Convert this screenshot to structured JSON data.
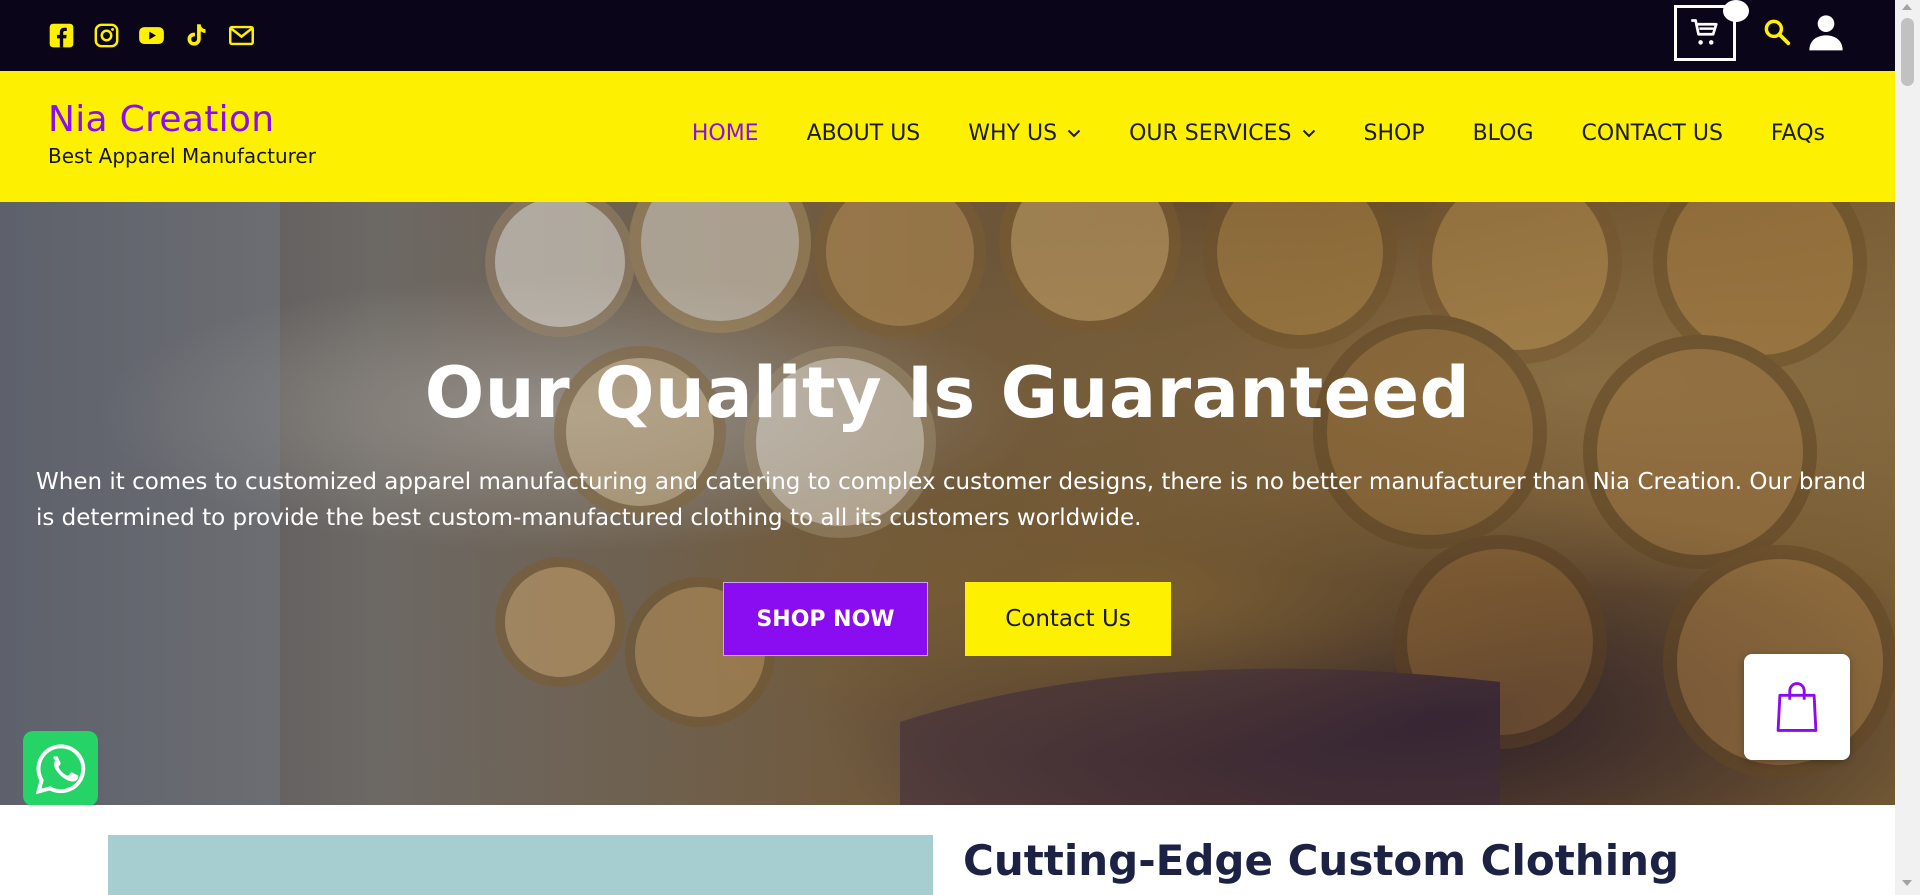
{
  "topbar": {
    "social_icons": [
      "facebook-icon",
      "instagram-icon",
      "youtube-icon",
      "tiktok-icon",
      "email-icon"
    ],
    "icons": [
      "cart-icon",
      "search-icon",
      "account-icon"
    ],
    "colors": {
      "background": "#0b0519",
      "icon": "#fdf000"
    }
  },
  "header": {
    "brand_title": "Nia Creation",
    "brand_tagline": "Best Apparel Manufacturer",
    "nav": {
      "home": "HOME",
      "about": "ABOUT US",
      "why": "WHY US",
      "services": "OUR SERVICES",
      "shop": "SHOP",
      "blog": "BLOG",
      "contact": "CONTACT US",
      "faqs": "FAQs"
    },
    "active_item": "HOME",
    "colors": {
      "background": "#fdf000",
      "accent": "#8a0cf0"
    }
  },
  "hero": {
    "title": "Our Quality Is Guaranteed",
    "text": "When it comes to customized apparel manufacturing and catering to complex customer designs, there is no better manufacturer than Nia Creation. Our brand is determined to provide the best custom-manufactured clothing to all its customers worldwide.",
    "shop_button": "SHOP NOW",
    "contact_button": "Contact Us"
  },
  "widgets": {
    "bag_icon": "shopping-bag-icon",
    "whatsapp_icon": "whatsapp-icon"
  },
  "section": {
    "title": "Cutting-Edge Custom Clothing"
  }
}
